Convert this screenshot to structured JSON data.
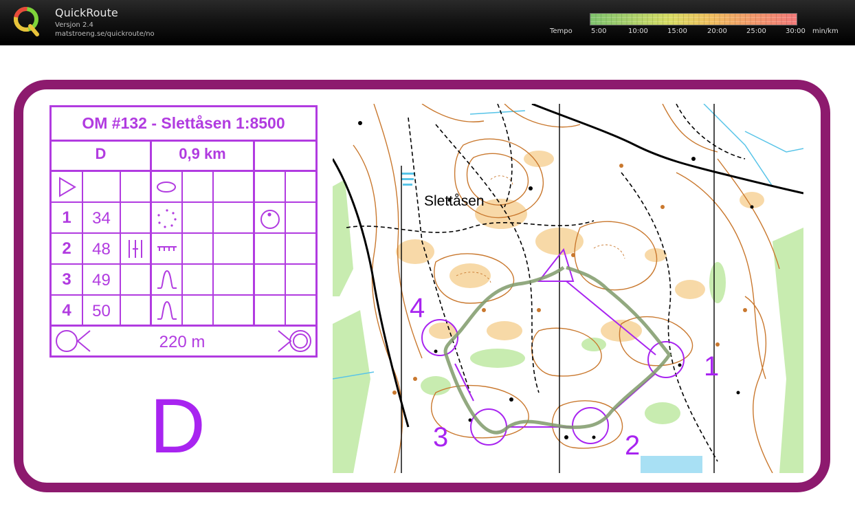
{
  "app": {
    "title": "QuickRoute",
    "version": "Versjon 2.4",
    "url": "matstroeng.se/quickroute/no"
  },
  "tempo": {
    "label": "Tempo",
    "ticks": [
      "5:00",
      "10:00",
      "15:00",
      "20:00",
      "25:00",
      "30:00"
    ],
    "unit": "min/km",
    "gradient_colors": [
      "#7fc36e",
      "#d7dc64",
      "#f0c060",
      "#f27a7a"
    ]
  },
  "course": {
    "title": "OM #132 - Slettåsen 1:8500",
    "class": "D",
    "length": "0,9 km",
    "start_symbol": "start-triangle-icon",
    "controls": [
      {
        "number": "1",
        "code": "34",
        "symbol": "circle-dot-icon"
      },
      {
        "number": "2",
        "code": "48",
        "symbol": "stream-crossing-icon"
      },
      {
        "number": "3",
        "code": "49",
        "symbol": "knoll-icon"
      },
      {
        "number": "4",
        "code": "50",
        "symbol": "knoll-icon"
      }
    ],
    "finish_distance": "220 m",
    "big_class_label": "D"
  },
  "map": {
    "place_name": "Slettåsen",
    "control_labels": [
      "1",
      "2",
      "3",
      "4"
    ],
    "colors": {
      "course": "#a824f0",
      "route": "#7f9a6a",
      "contour": "#c9782e",
      "open_land": "#f7d59e",
      "vegetation": "#c8ecb0",
      "water": "#58c4e8",
      "frame": "#8d1a6e"
    }
  }
}
